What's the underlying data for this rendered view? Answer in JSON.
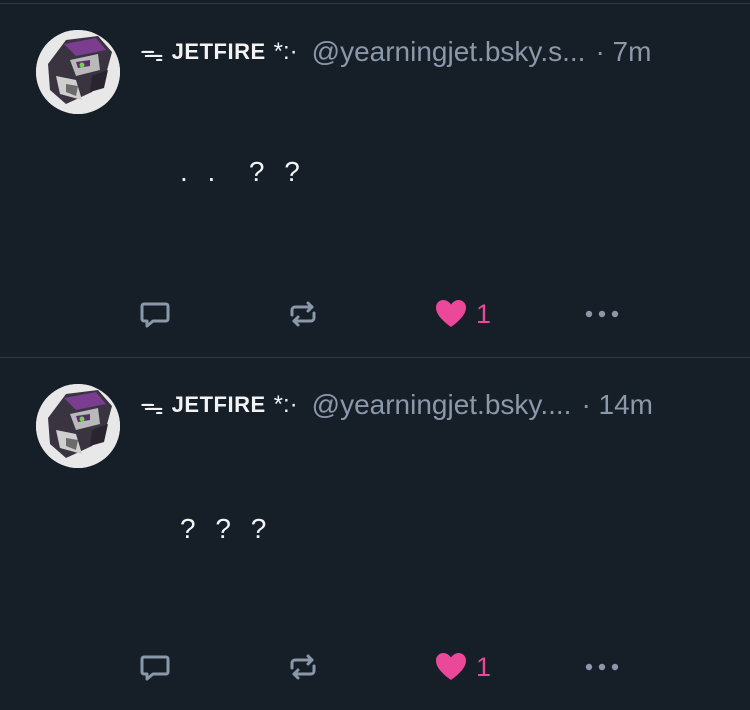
{
  "posts": [
    {
      "author": {
        "prefix": "ᯓ",
        "name": "JETFIRE",
        "suffix": "*:·",
        "handle": "@yearningjet.bsky.s..."
      },
      "time": "· 7m",
      "text": ". .  ? ?",
      "likes": "1",
      "liked": true
    },
    {
      "author": {
        "prefix": "ᯓ",
        "name": "JETFIRE",
        "suffix": "*:·",
        "handle": "@yearningjet.bsky...."
      },
      "time": "· 14m",
      "text": "? ? ?",
      "likes": "1",
      "liked": true
    }
  ],
  "icons": {
    "reply": "speech-bubble-icon",
    "repost": "repost-arrows-icon",
    "like": "heart-icon",
    "more": "ellipsis-icon"
  },
  "colors": {
    "background": "#161e27",
    "divider": "#2e3845",
    "muted_text": "#8b98a9",
    "like_pink": "#ec4899",
    "icon_gray": "#8b98a9"
  }
}
